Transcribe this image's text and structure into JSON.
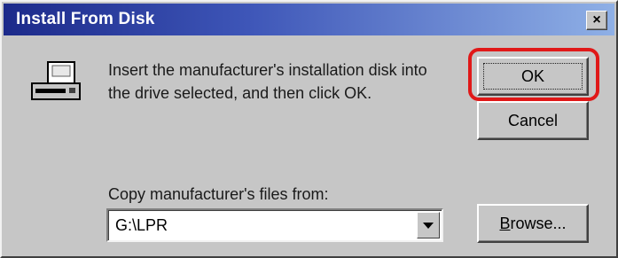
{
  "window": {
    "title": "Install From Disk",
    "close_glyph": "×"
  },
  "message": "Insert the manufacturer's installation disk into\nthe drive selected, and then click OK.",
  "buttons": {
    "ok": "OK",
    "cancel": "Cancel",
    "browse": "Browse..."
  },
  "copy_from": {
    "label": "Copy manufacturer's files from:",
    "value": "G:\\LPR"
  },
  "icons": {
    "disk": "disk-drive-icon",
    "dropdown": "chevron-down-icon",
    "close": "close-icon"
  },
  "colors": {
    "title_gradient_start": "#1c2a8a",
    "title_gradient_end": "#8fb0e6",
    "face": "#c6c6c6",
    "highlight": "#e01818"
  }
}
